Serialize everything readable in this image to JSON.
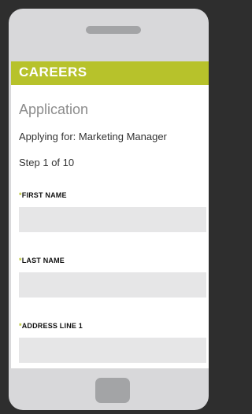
{
  "header": {
    "brand": "CAREERS"
  },
  "application": {
    "title": "Application",
    "applying_for": "Applying for: Marketing Manager",
    "step": "Step 1 of 10"
  },
  "fields": [
    {
      "required_mark": "*",
      "label": "FIRST NAME",
      "value": ""
    },
    {
      "required_mark": "*",
      "label": "LAST NAME",
      "value": ""
    },
    {
      "required_mark": "*",
      "label": "ADDRESS LINE 1",
      "value": ""
    }
  ],
  "colors": {
    "accent": "#b7c22b",
    "device": "#d8d8da",
    "input_bg": "#e6e6e7"
  }
}
